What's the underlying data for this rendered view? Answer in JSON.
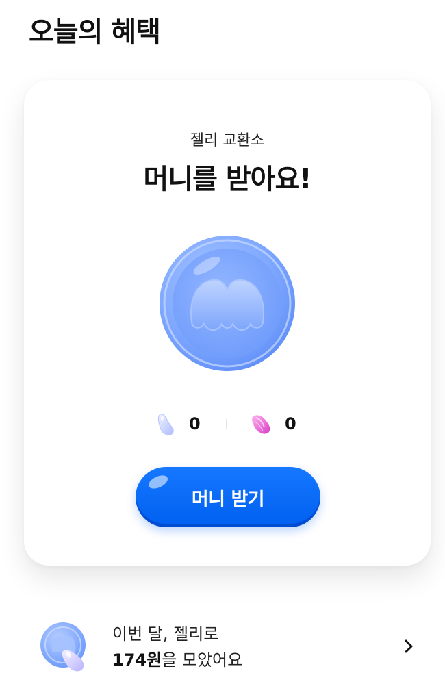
{
  "header": {
    "title": "오늘의 혜택"
  },
  "card": {
    "subtitle": "젤리 교환소",
    "title": "머니를 받아요!",
    "coin_icon": "money-coin-icon",
    "jelly_counts": [
      {
        "icon": "blue-jelly-icon",
        "value": "0"
      },
      {
        "icon": "pink-jelly-icon",
        "value": "0"
      }
    ],
    "cta_label": "머니 받기"
  },
  "monthly": {
    "line1": "이번 달, 젤리로",
    "amount": "174원",
    "suffix": "을 모았어요"
  },
  "colors": {
    "accent": "#0064FF",
    "coin": "#7AA6FF",
    "pink_jelly": "#E84FD0"
  }
}
